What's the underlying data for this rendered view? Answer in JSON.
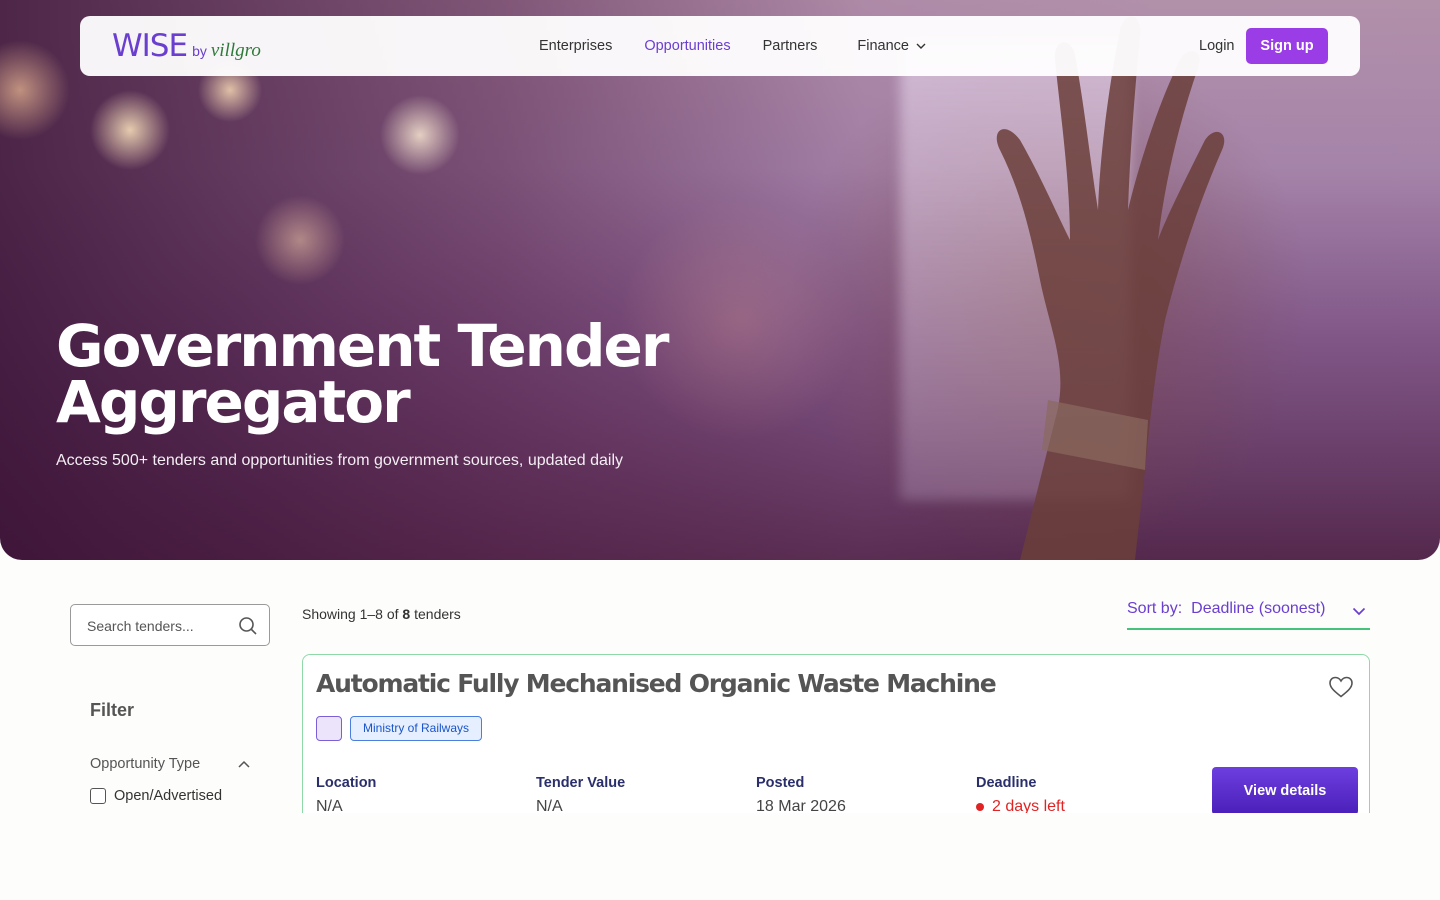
{
  "brand": {
    "wise": "WISE",
    "by": "by",
    "partner": "villgro"
  },
  "nav": {
    "links": [
      {
        "label": "Enterprises"
      },
      {
        "label": "Opportunities"
      },
      {
        "label": "Partners"
      },
      {
        "label": "Finance"
      }
    ],
    "login_label": "Login",
    "signup_label": "Sign up"
  },
  "hero": {
    "title_line1": "Government Tender",
    "title_line2": "Aggregator",
    "subtitle": "Access 500+ tenders and opportunities from government sources, updated daily"
  },
  "sidebar": {
    "search_placeholder": "Search tenders...",
    "filter_title": "Filter",
    "opportunity_type_label": "Opportunity Type",
    "options": [
      {
        "label": "Open/Advertised",
        "checked": false
      }
    ]
  },
  "results": {
    "showing_prefix": "Showing 1–8 of",
    "showing_count": "8",
    "showing_suffix": "tenders",
    "sort_label": "Sort by:",
    "sort_value": "Deadline (soonest)"
  },
  "tenders": [
    {
      "title": "Automatic Fully Mechanised Organic Waste Machine",
      "tag": "Ministry of Railways",
      "location_label": "Location",
      "location": "N/A",
      "value_label": "Tender Value",
      "value": "N/A",
      "posted_label": "Posted",
      "posted": "18 Mar 2026",
      "deadline_label": "Deadline",
      "deadline": "2 days left",
      "action_label": "View details"
    }
  ],
  "colors": {
    "accent": "#6a3fd0",
    "signup": "#9b3de6",
    "deadline": "#e02424",
    "card_border": "#8fd9a8"
  },
  "icons": [
    "search-icon",
    "chevron-down-icon",
    "chevron-up-icon",
    "heart-icon"
  ]
}
